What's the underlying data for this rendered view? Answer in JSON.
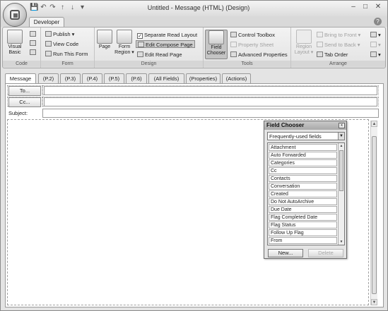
{
  "window": {
    "title": "Untitled - Message (HTML) (Design)",
    "minimize": "–",
    "maximize": "□",
    "close": "✕"
  },
  "quick_access": {
    "save": "💾",
    "undo": "↶",
    "redo": "↷",
    "up": "↑",
    "down": "↓",
    "more": "▾"
  },
  "ribbon_tabs": [
    "Developer"
  ],
  "help": "?",
  "ribbon": {
    "code": {
      "label": "Code",
      "visual_basic": "Visual Basic"
    },
    "form": {
      "label": "Form",
      "publish": "Publish ▾",
      "view_code": "View Code",
      "run_this_form": "Run This Form"
    },
    "design": {
      "label": "Design",
      "page": "Page",
      "form_region": "Form Region ▾",
      "separate_read_layout": "Separate Read Layout",
      "edit_compose_page": "Edit Compose Page",
      "edit_read_page": "Edit Read Page"
    },
    "tools": {
      "label": "Tools",
      "field_chooser": "Field Chooser",
      "control_toolbox": "Control Toolbox",
      "property_sheet": "Property Sheet",
      "advanced_properties": "Advanced Properties"
    },
    "arrange": {
      "label": "Arrange",
      "region_layout": "Region Layout ▾",
      "bring_to_front": "Bring to Front ▾",
      "send_to_back": "Send to Back ▾",
      "tab_order": "Tab Order"
    }
  },
  "page_tabs": [
    "Message",
    "(P.2)",
    "(P.3)",
    "(P.4)",
    "(P.5)",
    "(P.6)",
    "(All Fields)",
    "(Properties)",
    "(Actions)"
  ],
  "form": {
    "to_button": "To...",
    "cc_button": "Cc...",
    "subject_label": "Subject:"
  },
  "field_chooser": {
    "title": "Field Chooser",
    "close": "x",
    "selected_set": "Frequently-used fields",
    "fields": [
      "Attachment",
      "Auto Forwarded",
      "Categories",
      "Cc",
      "Contacts",
      "Conversation",
      "Created",
      "Do Not AutoArchive",
      "Due Date",
      "Flag Completed Date",
      "Flag Status",
      "Follow Up Flag",
      "From"
    ],
    "new_button": "New...",
    "delete_button": "Delete"
  }
}
